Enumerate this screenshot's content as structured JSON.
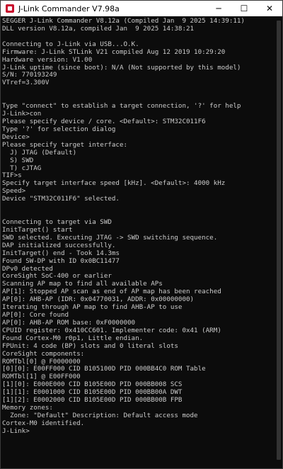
{
  "window": {
    "title": "J-Link Commander V7.98a",
    "minimize_glyph": "─",
    "maximize_glyph": "☐",
    "close_glyph": "✕"
  },
  "console": {
    "lines": [
      "SEGGER J-Link Commander V8.12a (Compiled Jan  9 2025 14:39:11)",
      "DLL version V8.12a, compiled Jan  9 2025 14:38:21",
      "",
      "Connecting to J-Link via USB...O.K.",
      "Firmware: J-Link STLink V21 compiled Aug 12 2019 10:29:20",
      "Hardware version: V1.00",
      "J-Link uptime (since boot): N/A (Not supported by this model)",
      "S/N: 770193249",
      "VTref=3.300V",
      "",
      "",
      "Type \"connect\" to establish a target connection, '?' for help",
      "J-Link>con",
      "Please specify device / core. <Default>: STM32C011F6",
      "Type '?' for selection dialog",
      "Device>",
      "Please specify target interface:",
      "  J) JTAG (Default)",
      "  S) SWD",
      "  T) cJTAG",
      "TIF>s",
      "Specify target interface speed [kHz]. <Default>: 4000 kHz",
      "Speed>",
      "Device \"STM32C011F6\" selected.",
      "",
      "",
      "Connecting to target via SWD",
      "InitTarget() start",
      "SWD selected. Executing JTAG -> SWD switching sequence.",
      "DAP initialized successfully.",
      "InitTarget() end - Took 14.3ms",
      "Found SW-DP with ID 0x0BC11477",
      "DPv0 detected",
      "CoreSight SoC-400 or earlier",
      "Scanning AP map to find all available APs",
      "AP[1]: Stopped AP scan as end of AP map has been reached",
      "AP[0]: AHB-AP (IDR: 0x04770031, ADDR: 0x00000000)",
      "Iterating through AP map to find AHB-AP to use",
      "AP[0]: Core found",
      "AP[0]: AHB-AP ROM base: 0xF0000000",
      "CPUID register: 0x410CC601. Implementer code: 0x41 (ARM)",
      "Found Cortex-M0 r0p1, Little endian.",
      "FPUnit: 4 code (BP) slots and 0 literal slots",
      "CoreSight components:",
      "ROMTbl[0] @ F0000000",
      "[0][0]: E00FF000 CID B105100D PID 000BB4C0 ROM Table",
      "ROMTbl[1] @ E00FF000",
      "[1][0]: E000E000 CID B105E00D PID 000BB008 SCS",
      "[1][1]: E0001000 CID B105E00D PID 000BB00A DWT",
      "[1][2]: E0002000 CID B105E00D PID 000BB00B FPB",
      "Memory zones:",
      "  Zone: \"Default\" Description: Default access mode",
      "Cortex-M0 identified.",
      "J-Link>"
    ]
  }
}
